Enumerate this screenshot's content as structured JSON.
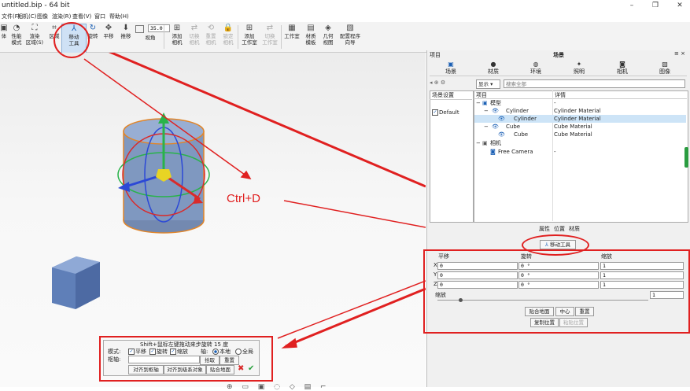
{
  "window": {
    "title": "untitled.bip - 64 bit"
  },
  "menu": [
    "文件(F)",
    "相机(C)",
    "图像",
    "渲染(R)",
    "查看(V)",
    "窗口",
    "帮助(H)"
  ],
  "toolbar": {
    "items": [
      {
        "label": "体"
      },
      {
        "label": "性能\n模式"
      },
      {
        "label": "渲染\n区域(S)"
      },
      {
        "label": "区域"
      },
      {
        "label": "移动\n工具"
      },
      {
        "label": "旋转"
      },
      {
        "label": "平移"
      },
      {
        "label": "推移"
      },
      {
        "label": "视角"
      },
      {
        "label": "添加\n相机"
      },
      {
        "label": "切换\n相机"
      },
      {
        "label": "重置\n相机"
      },
      {
        "label": "锁定\n相机"
      },
      {
        "label": "添加\n工作室"
      },
      {
        "label": "切换\n工作室"
      },
      {
        "label": "工作室"
      },
      {
        "label": "材质\n模板"
      },
      {
        "label": "几何\n视图"
      },
      {
        "label": "配置程序\n向导"
      }
    ],
    "fov_value": "35.0"
  },
  "annotation": {
    "shortcut": "Ctrl+D"
  },
  "right_panel": {
    "header_left": "项目",
    "header_center": "场景",
    "tabs": [
      "场景",
      "材质",
      "环境",
      "照明",
      "相机",
      "图像"
    ],
    "display_dropdown": "显示",
    "search_placeholder": "搜索全部",
    "scene_settings": "场景设置",
    "default_item": "Default",
    "tree_headers": [
      "项目",
      "详情"
    ],
    "tree": [
      {
        "name": "模型",
        "detail": "-"
      },
      {
        "name": "Cylinder",
        "detail": "Cylinder Material"
      },
      {
        "name": "Cylinder",
        "detail": "Cylinder Material"
      },
      {
        "name": "Cube",
        "detail": "Cube Material"
      },
      {
        "name": "Cube",
        "detail": "Cube Material"
      },
      {
        "name": "相机",
        "detail": ""
      },
      {
        "name": "Free Camera",
        "detail": "-"
      }
    ],
    "subtabs": [
      "属性",
      "位置",
      "材质"
    ],
    "move_tool_button": "移动工具",
    "transform": {
      "translate_label": "平移",
      "rotate_label": "旋转",
      "scale_label": "缩放",
      "axes": [
        "X",
        "Y",
        "Z"
      ],
      "translate_values": [
        "0",
        "0",
        "0"
      ],
      "rotate_values": [
        "0 °",
        "0 °",
        "0 °"
      ],
      "scale_values": [
        "1",
        "1",
        "1"
      ],
      "uniform_scale_label": "缩放",
      "uniform_scale_value": "1",
      "buttons": [
        "贴合地面",
        "中心",
        "重置"
      ],
      "copy_position": "复制位置",
      "paste_position": "粘贴位置"
    }
  },
  "floating_tool": {
    "hint": "Shift+鼠标左键拖动来步旋转 15 度",
    "mode_label": "模式:",
    "mode_options": [
      "平移",
      "旋转",
      "缩放"
    ],
    "axis_label": "轴:",
    "axis_options": [
      "本地",
      "全局"
    ],
    "pivot_label": "枢轴:",
    "pick_button": "拾取",
    "reset_button": "重置",
    "buttons": [
      "对齐到枢轴",
      "对齐到级系对象",
      "贴合地面"
    ]
  },
  "colors": {
    "accent": "#e02020",
    "selection": "#cde4f7",
    "cylinder": "#7f98c0",
    "cube": "#6c8fc9"
  }
}
